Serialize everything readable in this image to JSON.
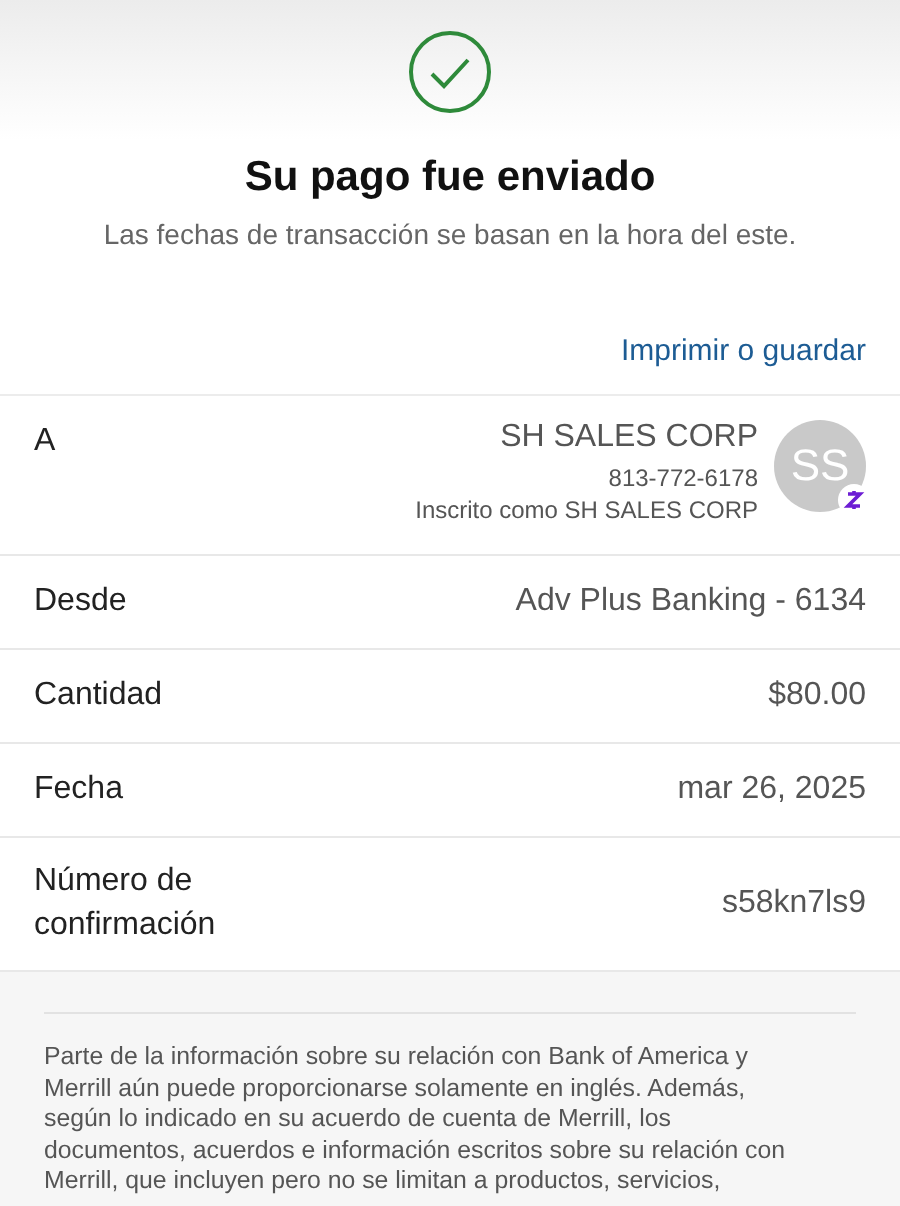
{
  "header": {
    "title": "Su pago fue enviado",
    "subtitle": "Las fechas de transacción se basan en la hora del este."
  },
  "print_link": "Imprimir o guardar",
  "rows": [
    {
      "kind": "recipient",
      "label": "A",
      "name": "SH SALES CORP",
      "phone": "813-772-6178",
      "enrolled": "Inscrito como SH SALES CORP",
      "avatar": "SS"
    },
    {
      "kind": "plain",
      "label": "Desde",
      "value": "Adv Plus Banking - 6134"
    },
    {
      "kind": "plain",
      "label": "Cantidad",
      "value": "$80.00"
    },
    {
      "kind": "plain",
      "label": "Fecha",
      "value": "mar 26, 2025"
    },
    {
      "kind": "plain",
      "label": "Número de confirmación",
      "value": "s58kn7ls9"
    }
  ],
  "disclaimer": "Parte de la información sobre su relación con Bank of America y Merrill aún puede proporcionarse solamente en inglés. Además, según lo indicado en su acuerdo de cuenta de Merrill, los documentos, acuerdos e información escritos sobre su relación con Merrill, que incluyen pero no se limitan a productos, servicios,"
}
